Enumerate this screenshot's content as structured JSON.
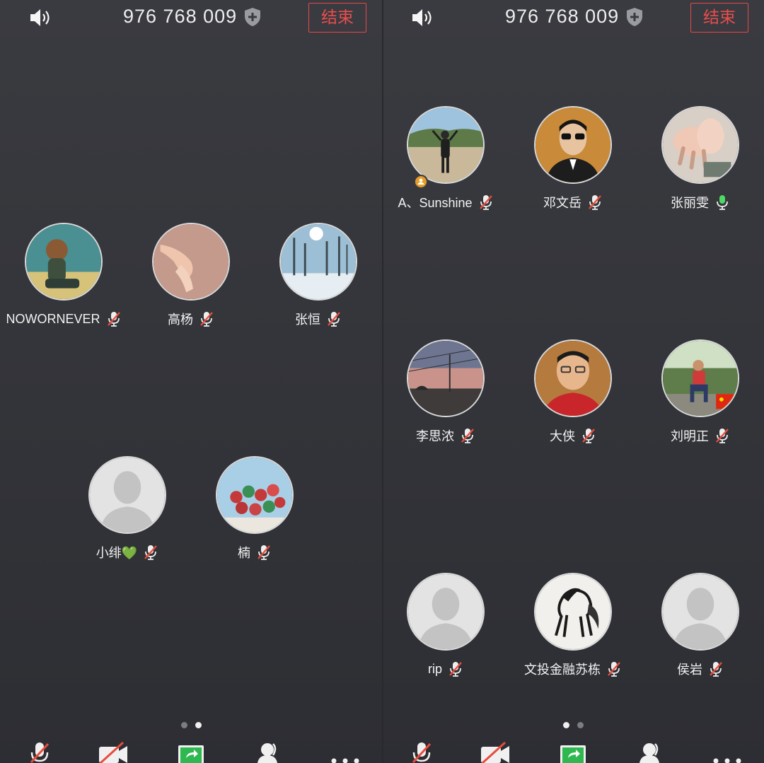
{
  "left": {
    "meeting_id": "976 768 009",
    "end_label": "结束",
    "participants": [
      {
        "name": "NOWORNEVER"
      },
      {
        "name": "高杨"
      },
      {
        "name": "张恒"
      },
      {
        "name": "小绯💚"
      },
      {
        "name": "楠"
      }
    ],
    "page": {
      "current": 2,
      "total": 2
    }
  },
  "right": {
    "meeting_id": "976 768 009",
    "end_label": "结束",
    "participants": [
      {
        "name": "A、Sunshine"
      },
      {
        "name": "邓文岳"
      },
      {
        "name": "张丽雯"
      },
      {
        "name": "李思浓"
      },
      {
        "name": "大侠"
      },
      {
        "name": "刘明正"
      },
      {
        "name": "rip"
      },
      {
        "name": "文投金融苏栋"
      },
      {
        "name": "侯岩"
      }
    ],
    "page": {
      "current": 1,
      "total": 2
    }
  },
  "icons": {
    "speaker": "speaker-icon",
    "shield": "shield-plus-icon",
    "mic_muted": "mic-muted-icon",
    "mic_active": "mic-active-icon",
    "host": "host-badge-icon",
    "toolbar": [
      "mic-muted-icon",
      "camera-off-icon",
      "share-screen-icon",
      "participants-icon",
      "more-icon"
    ]
  },
  "colors": {
    "background": "#34353a",
    "end_button": "#e24a4a",
    "mic_muted_slash": "#e84c3d",
    "mic_active": "#4cd964",
    "host_badge": "#e79d2a",
    "share_button": "#2fb84f"
  }
}
